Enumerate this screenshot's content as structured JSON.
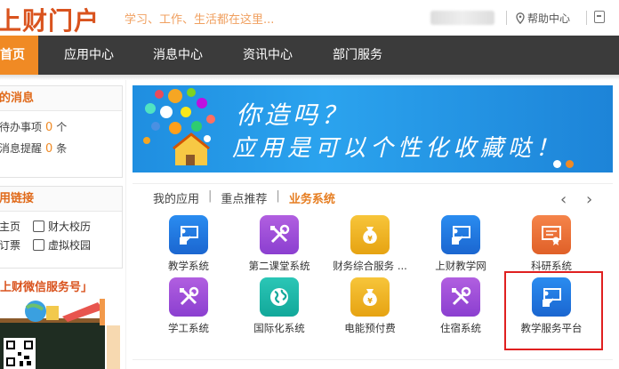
{
  "header": {
    "logo_text": "上财门户",
    "slogan": "学习、工作、生活都在这里...",
    "help_label": "帮助中心"
  },
  "nav": {
    "items": [
      "首页",
      "应用中心",
      "消息中心",
      "资讯中心",
      "部门服务"
    ]
  },
  "sidebar": {
    "messages_title": "的消息",
    "todo_label": "待办事项",
    "todo_count": "0",
    "todo_unit": "个",
    "reminder_label": "消息提醒",
    "reminder_count": "0",
    "reminder_unit": "条",
    "links_title": "用链接",
    "links": [
      "主页",
      "财大校历",
      "订票",
      "虚拟校园"
    ],
    "wechat_title": "上财微信服务号」"
  },
  "banner": {
    "line1": "你造吗？",
    "line2": "应用是可以个性化收藏哒！"
  },
  "tabs": {
    "items": [
      "我的应用",
      "重点推荐",
      "业务系统"
    ],
    "active_index": 2
  },
  "apps": [
    {
      "label": "教学系统",
      "color": "blue",
      "icon": "teacher-board-icon"
    },
    {
      "label": "第二课堂系统",
      "color": "purple",
      "icon": "tools-icon"
    },
    {
      "label": "财务综合服务 ...",
      "color": "gold",
      "icon": "money-bag-icon"
    },
    {
      "label": "上财教学网",
      "color": "blue",
      "icon": "teacher-board-icon"
    },
    {
      "label": "科研系统",
      "color": "orange",
      "icon": "certificate-icon"
    },
    {
      "label": "学工系统",
      "color": "purple",
      "icon": "tools-icon"
    },
    {
      "label": "国际化系统",
      "color": "teal",
      "icon": "globe-icon"
    },
    {
      "label": "电能预付费",
      "color": "gold",
      "icon": "money-bag-icon"
    },
    {
      "label": "住宿系统",
      "color": "purple",
      "icon": "tools-icon"
    },
    {
      "label": "教学服务平台",
      "color": "blue",
      "icon": "teacher-board-icon"
    }
  ],
  "colors": {
    "accent": "#f08a24",
    "nav_bg": "#3b3b3b",
    "highlight": "#e02020"
  }
}
